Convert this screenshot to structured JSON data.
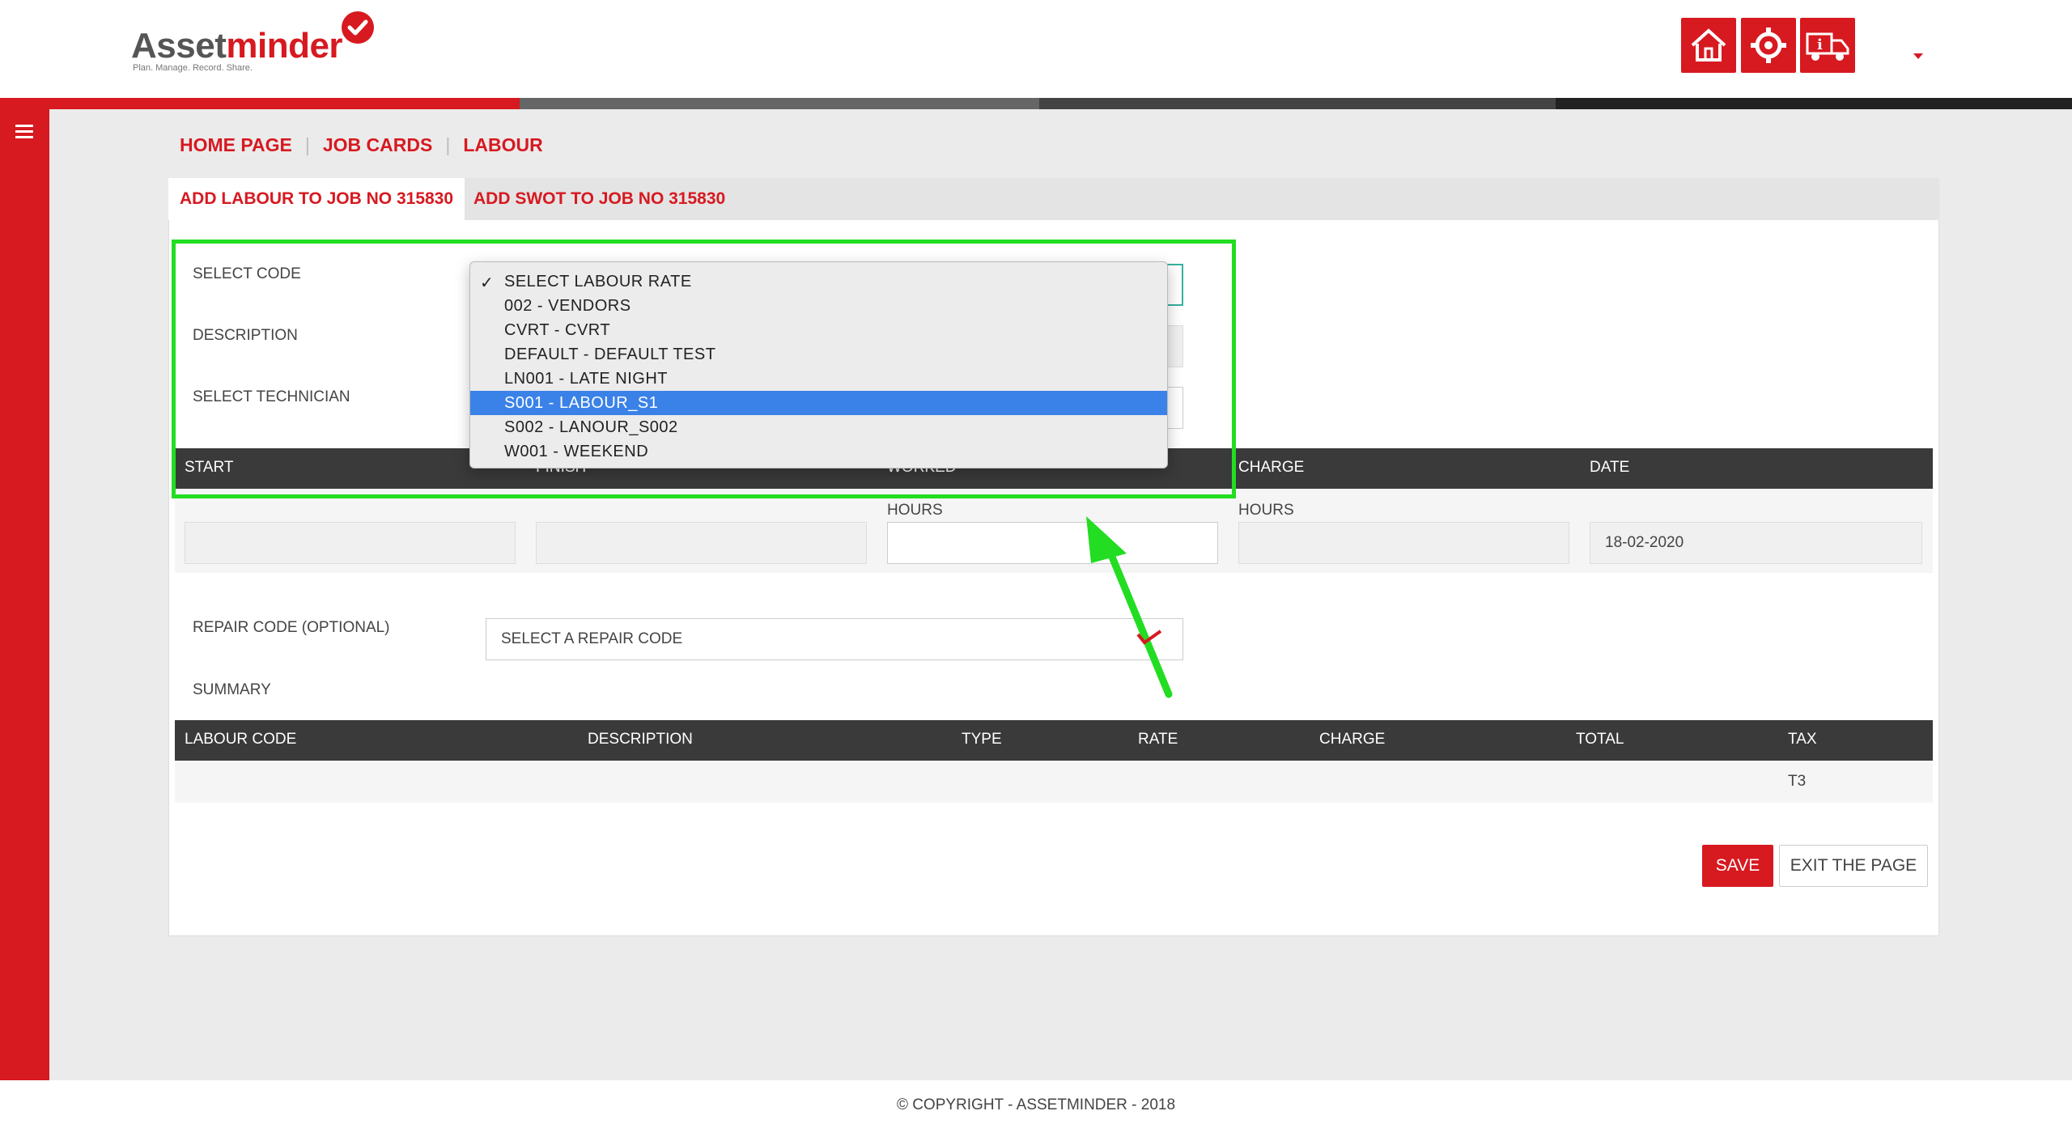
{
  "header": {
    "logo_prefix": "Asset",
    "logo_suffix": "minder",
    "logo_tagline": "Plan. Manage. Record. Share.",
    "icons": [
      "home-icon",
      "settings-icon",
      "truck-info-icon"
    ]
  },
  "breadcrumb": [
    "HOME PAGE",
    "JOB CARDS",
    "LABOUR"
  ],
  "tabs": [
    "ADD LABOUR TO JOB NO 315830",
    "ADD SWOT TO JOB NO 315830"
  ],
  "form": {
    "select_code_label": "SELECT CODE",
    "description_label": "DESCRIPTION",
    "select_technician_label": "SELECT TECHNICIAN",
    "repair_code_label": "REPAIR CODE (OPTIONAL)",
    "repair_code_value": "SELECT A REPAIR CODE",
    "summary_label": "SUMMARY"
  },
  "time_table": {
    "headers": [
      "START",
      "FINISH",
      "WORKED",
      "CHARGE",
      "DATE"
    ],
    "sub_labels": {
      "worked": "HOURS",
      "charge": "HOURS"
    },
    "date_value": "18-02-2020"
  },
  "summary_table": {
    "headers": [
      "LABOUR CODE",
      "DESCRIPTION",
      "TYPE",
      "RATE",
      "CHARGE",
      "TOTAL",
      "TAX"
    ],
    "row": {
      "tax": "T3"
    }
  },
  "buttons": {
    "save": "SAVE",
    "exit": "EXIT THE PAGE"
  },
  "footer": "© COPYRIGHT - ASSETMINDER - 2018",
  "dropdown": {
    "options": [
      "SELECT LABOUR RATE",
      "002 - VENDORS",
      "CVRT - CVRT",
      "DEFAULT - DEFAULT TEST",
      "LN001 - LATE NIGHT",
      "S001 - LABOUR_S1",
      "S002 - LANOUR_S002",
      "W001 - WEEKEND"
    ],
    "checked": "SELECT LABOUR RATE",
    "highlighted": "S001 - LABOUR_S1"
  },
  "colors": {
    "brand_red": "#d71920",
    "highlight_green": "#22dd22",
    "selection_blue": "#3b82e8",
    "table_header": "#3a3a3a"
  }
}
